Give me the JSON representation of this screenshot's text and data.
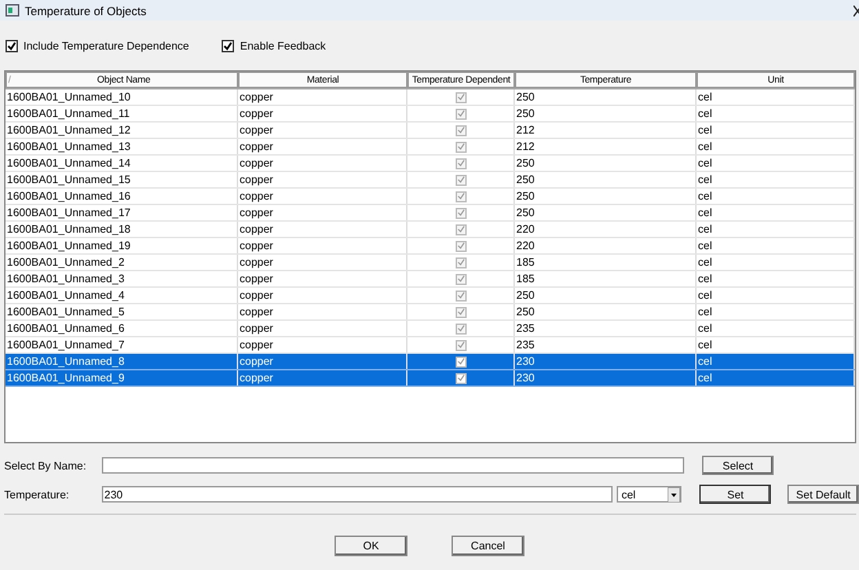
{
  "window": {
    "title": "Temperature of Objects"
  },
  "options": [
    {
      "label": "Include Temperature Dependence",
      "checked": true
    },
    {
      "label": "Enable Feedback",
      "checked": true
    }
  ],
  "table": {
    "sort_mark": "/",
    "columns": [
      "Object Name",
      "Material",
      "Temperature Dependent",
      "Temperature",
      "Unit"
    ],
    "rows": [
      {
        "name": "1600BA01_Unnamed_10",
        "material": "copper",
        "temperature_dependent": true,
        "temperature": "250",
        "unit": "cel",
        "selected": false
      },
      {
        "name": "1600BA01_Unnamed_11",
        "material": "copper",
        "temperature_dependent": true,
        "temperature": "250",
        "unit": "cel",
        "selected": false
      },
      {
        "name": "1600BA01_Unnamed_12",
        "material": "copper",
        "temperature_dependent": true,
        "temperature": "212",
        "unit": "cel",
        "selected": false
      },
      {
        "name": "1600BA01_Unnamed_13",
        "material": "copper",
        "temperature_dependent": true,
        "temperature": "212",
        "unit": "cel",
        "selected": false
      },
      {
        "name": "1600BA01_Unnamed_14",
        "material": "copper",
        "temperature_dependent": true,
        "temperature": "250",
        "unit": "cel",
        "selected": false
      },
      {
        "name": "1600BA01_Unnamed_15",
        "material": "copper",
        "temperature_dependent": true,
        "temperature": "250",
        "unit": "cel",
        "selected": false
      },
      {
        "name": "1600BA01_Unnamed_16",
        "material": "copper",
        "temperature_dependent": true,
        "temperature": "250",
        "unit": "cel",
        "selected": false
      },
      {
        "name": "1600BA01_Unnamed_17",
        "material": "copper",
        "temperature_dependent": true,
        "temperature": "250",
        "unit": "cel",
        "selected": false
      },
      {
        "name": "1600BA01_Unnamed_18",
        "material": "copper",
        "temperature_dependent": true,
        "temperature": "220",
        "unit": "cel",
        "selected": false
      },
      {
        "name": "1600BA01_Unnamed_19",
        "material": "copper",
        "temperature_dependent": true,
        "temperature": "220",
        "unit": "cel",
        "selected": false
      },
      {
        "name": "1600BA01_Unnamed_2",
        "material": "copper",
        "temperature_dependent": true,
        "temperature": "185",
        "unit": "cel",
        "selected": false
      },
      {
        "name": "1600BA01_Unnamed_3",
        "material": "copper",
        "temperature_dependent": true,
        "temperature": "185",
        "unit": "cel",
        "selected": false
      },
      {
        "name": "1600BA01_Unnamed_4",
        "material": "copper",
        "temperature_dependent": true,
        "temperature": "250",
        "unit": "cel",
        "selected": false
      },
      {
        "name": "1600BA01_Unnamed_5",
        "material": "copper",
        "temperature_dependent": true,
        "temperature": "250",
        "unit": "cel",
        "selected": false
      },
      {
        "name": "1600BA01_Unnamed_6",
        "material": "copper",
        "temperature_dependent": true,
        "temperature": "235",
        "unit": "cel",
        "selected": false
      },
      {
        "name": "1600BA01_Unnamed_7",
        "material": "copper",
        "temperature_dependent": true,
        "temperature": "235",
        "unit": "cel",
        "selected": false
      },
      {
        "name": "1600BA01_Unnamed_8",
        "material": "copper",
        "temperature_dependent": true,
        "temperature": "230",
        "unit": "cel",
        "selected": true
      },
      {
        "name": "1600BA01_Unnamed_9",
        "material": "copper",
        "temperature_dependent": true,
        "temperature": "230",
        "unit": "cel",
        "selected": true
      }
    ]
  },
  "select_by_name": {
    "label": "Select By Name:",
    "button": "Select"
  },
  "temperature": {
    "label": "Temperature:",
    "value": "230",
    "unit": "cel",
    "set_button": "Set",
    "default_button": "Set Default"
  },
  "buttons": [
    "OK",
    "Cancel"
  ]
}
